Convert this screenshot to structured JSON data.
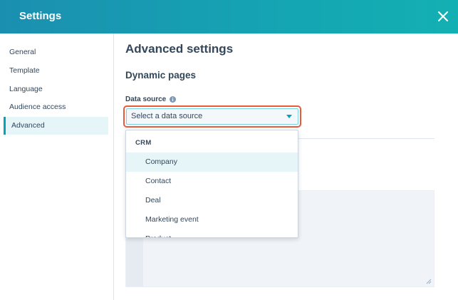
{
  "header": {
    "title": "Settings",
    "close_icon": "close-icon"
  },
  "sidebar": {
    "items": [
      {
        "label": "General",
        "active": false
      },
      {
        "label": "Template",
        "active": false
      },
      {
        "label": "Language",
        "active": false
      },
      {
        "label": "Audience access",
        "active": false
      },
      {
        "label": "Advanced",
        "active": true
      }
    ]
  },
  "main": {
    "title": "Advanced settings",
    "section": "Dynamic pages",
    "data_source": {
      "label": "Data source",
      "info_icon": "info-icon",
      "placeholder": "Select a data source",
      "caret_icon": "caret-down-icon"
    }
  },
  "dropdown": {
    "group": "CRM",
    "options": [
      "Company",
      "Contact",
      "Deal",
      "Marketing event",
      "Product"
    ],
    "hovered": "Company"
  },
  "colors": {
    "header_start": "#1b8fb0",
    "header_end": "#13b0b3",
    "accent": "#00a4bd",
    "highlight": "#e85b3a",
    "text": "#33475b"
  }
}
